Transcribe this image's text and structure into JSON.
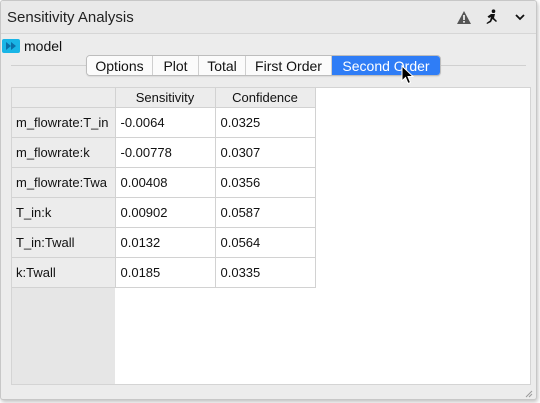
{
  "window": {
    "title": "Sensitivity Analysis"
  },
  "header_icons": [
    "warning-icon",
    "run-icon",
    "chevron-down-icon"
  ],
  "model": {
    "label": "model",
    "icon": "model-icon",
    "icon_color": "#19b5e6"
  },
  "tabs": [
    {
      "label": "Options",
      "active": false
    },
    {
      "label": "Plot",
      "active": false
    },
    {
      "label": "Total",
      "active": false
    },
    {
      "label": "First Order",
      "active": false
    },
    {
      "label": "Second Order",
      "active": true
    }
  ],
  "accent_color": "#2f7df6",
  "table": {
    "columns": [
      "Sensitivity",
      "Confidence"
    ],
    "rows": [
      {
        "label": "m_flowrate:T_in",
        "sensitivity": "-0.0064",
        "confidence": "0.0325"
      },
      {
        "label": "m_flowrate:k",
        "sensitivity": "-0.00778",
        "confidence": "0.0307"
      },
      {
        "label": "m_flowrate:Twa",
        "sensitivity": "0.00408",
        "confidence": "0.0356"
      },
      {
        "label": "T_in:k",
        "sensitivity": "0.00902",
        "confidence": "0.0587"
      },
      {
        "label": "T_in:Twall",
        "sensitivity": "0.0132",
        "confidence": "0.0564"
      },
      {
        "label": "k:Twall",
        "sensitivity": "0.0185",
        "confidence": "0.0335"
      }
    ]
  }
}
